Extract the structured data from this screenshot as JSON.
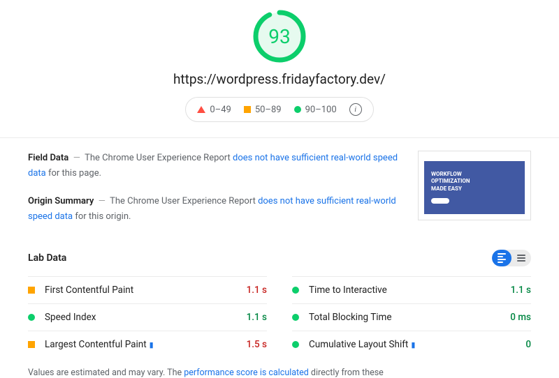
{
  "score": "93",
  "url": "https://wordpress.fridayfactory.dev/",
  "legend": {
    "poor": "0–49",
    "average": "50–89",
    "good": "90–100"
  },
  "field_data": {
    "label": "Field Data",
    "prefix": "The Chrome User Experience Report ",
    "link": "does not have sufficient real-world speed data",
    "suffix": " for this page."
  },
  "origin_summary": {
    "label": "Origin Summary",
    "prefix": "The Chrome User Experience Report ",
    "link": "does not have sufficient real-world speed data",
    "suffix": " for this origin."
  },
  "thumbnail": {
    "line1": "WORKFLOW",
    "line2": "OPTIMIZATION",
    "line3": "MADE EASY"
  },
  "lab_data_label": "Lab Data",
  "metrics": [
    {
      "name": "First Contentful Paint",
      "value": "1.1 s",
      "status": "average",
      "flag": false
    },
    {
      "name": "Time to Interactive",
      "value": "1.1 s",
      "status": "good",
      "flag": false
    },
    {
      "name": "Speed Index",
      "value": "1.1 s",
      "status": "good",
      "flag": false
    },
    {
      "name": "Total Blocking Time",
      "value": "0 ms",
      "status": "good",
      "flag": false
    },
    {
      "name": "Largest Contentful Paint",
      "value": "1.5 s",
      "status": "average",
      "flag": true
    },
    {
      "name": "Cumulative Layout Shift",
      "value": "0",
      "status": "good",
      "flag": true
    }
  ],
  "footnote": {
    "prefix": "Values are estimated and may vary. The ",
    "link": "performance score is calculated",
    "suffix": " directly from these"
  }
}
